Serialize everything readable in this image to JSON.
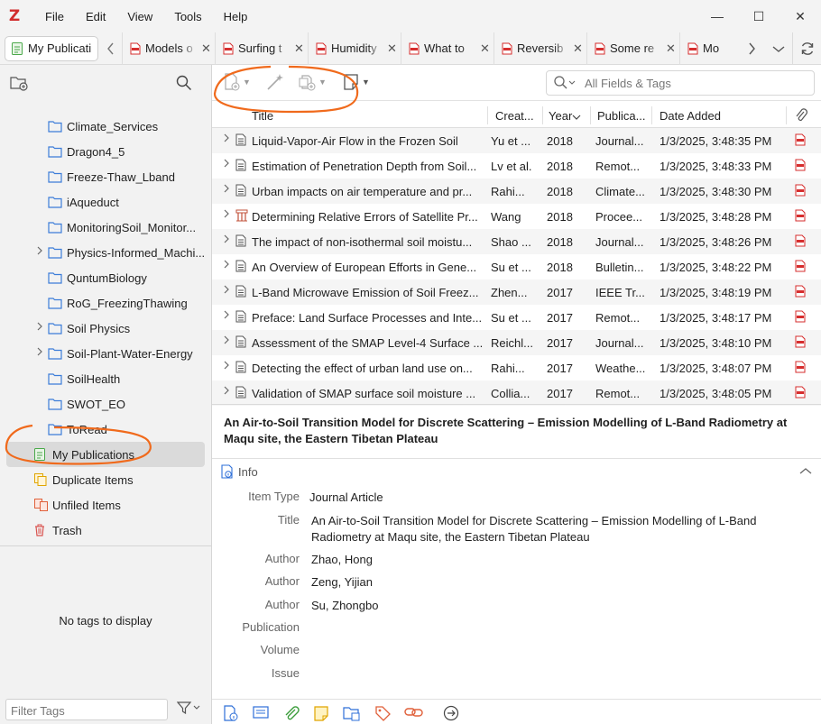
{
  "app": {
    "logo": "Z"
  },
  "menu": [
    "File",
    "Edit",
    "View",
    "Tools",
    "Help"
  ],
  "window_controls": {
    "minimize": "—",
    "maximize": "☐",
    "close": "✕"
  },
  "library_tab": {
    "label": "My Publicati"
  },
  "tabs": [
    {
      "label": "Models o"
    },
    {
      "label": "Surfing t"
    },
    {
      "label": "Humidity"
    },
    {
      "label": "What to"
    },
    {
      "label": "Reversib"
    },
    {
      "label": "Some re"
    },
    {
      "label": "Mo"
    }
  ],
  "collections": [
    {
      "label": "Climate_Services",
      "twisty": false
    },
    {
      "label": "Dragon4_5",
      "twisty": false
    },
    {
      "label": "Freeze-Thaw_Lband",
      "twisty": false
    },
    {
      "label": "iAqueduct",
      "twisty": false
    },
    {
      "label": "MonitoringSoil_Monitor...",
      "twisty": false
    },
    {
      "label": "Physics-Informed_Machi...",
      "twisty": true
    },
    {
      "label": "QuntumBiology",
      "twisty": false
    },
    {
      "label": "RoG_FreezingThawing",
      "twisty": false
    },
    {
      "label": "Soil Physics",
      "twisty": true
    },
    {
      "label": "Soil-Plant-Water-Energy",
      "twisty": true
    },
    {
      "label": "SoilHealth",
      "twisty": false
    },
    {
      "label": "SWOT_EO",
      "twisty": false
    },
    {
      "label": "ToRead",
      "twisty": false
    }
  ],
  "special": {
    "my_publications": "My Publications",
    "duplicate_items": "Duplicate Items",
    "unfiled_items": "Unfiled Items",
    "trash": "Trash"
  },
  "tags": {
    "empty": "No tags to display",
    "filter_placeholder": "Filter Tags"
  },
  "search": {
    "placeholder": "All Fields & Tags"
  },
  "columns": {
    "title": "Title",
    "creator": "Creat...",
    "year": "Year",
    "publication": "Publica...",
    "date_added": "Date Added"
  },
  "items": [
    {
      "title": "Liquid-Vapor-Air Flow in the Frozen Soil",
      "creator": "Yu et ...",
      "year": "2018",
      "publication": "Journal...",
      "date_added": "1/3/2025, 3:48:35 PM",
      "type": "article"
    },
    {
      "title": "Estimation of Penetration Depth from Soil...",
      "creator": "Lv et al.",
      "year": "2018",
      "publication": "Remot...",
      "date_added": "1/3/2025, 3:48:33 PM",
      "type": "article"
    },
    {
      "title": "Urban impacts on air temperature and pr...",
      "creator": "Rahi...",
      "year": "2018",
      "publication": "Climate...",
      "date_added": "1/3/2025, 3:48:30 PM",
      "type": "article"
    },
    {
      "title": "Determining Relative Errors of Satellite Pr...",
      "creator": "Wang",
      "year": "2018",
      "publication": "Procee...",
      "date_added": "1/3/2025, 3:48:28 PM",
      "type": "conference"
    },
    {
      "title": "The impact of non-isothermal soil moistu...",
      "creator": "Shao ...",
      "year": "2018",
      "publication": "Journal...",
      "date_added": "1/3/2025, 3:48:26 PM",
      "type": "article"
    },
    {
      "title": "An Overview of European Efforts in Gene...",
      "creator": "Su et ...",
      "year": "2018",
      "publication": "Bulletin...",
      "date_added": "1/3/2025, 3:48:22 PM",
      "type": "article"
    },
    {
      "title": "L-Band Microwave Emission of Soil Freez...",
      "creator": "Zhen...",
      "year": "2017",
      "publication": "IEEE Tr...",
      "date_added": "1/3/2025, 3:48:19 PM",
      "type": "article"
    },
    {
      "title": "Preface: Land Surface Processes and Inte...",
      "creator": "Su et ...",
      "year": "2017",
      "publication": "Remot...",
      "date_added": "1/3/2025, 3:48:17 PM",
      "type": "article"
    },
    {
      "title": "Assessment of the SMAP Level-4 Surface ...",
      "creator": "Reichl...",
      "year": "2017",
      "publication": "Journal...",
      "date_added": "1/3/2025, 3:48:10 PM",
      "type": "article"
    },
    {
      "title": "Detecting the effect of urban land use on...",
      "creator": "Rahi...",
      "year": "2017",
      "publication": "Weathe...",
      "date_added": "1/3/2025, 3:48:07 PM",
      "type": "article"
    },
    {
      "title": "Validation of SMAP surface soil moisture ...",
      "creator": "Collia...",
      "year": "2017",
      "publication": "Remot...",
      "date_added": "1/3/2025, 3:48:05 PM",
      "type": "article"
    }
  ],
  "item_pane": {
    "header_title": "An Air-to-Soil Transition Model for Discrete Scattering – Emission Modelling of L-Band Radiometry at Maqu site, the Eastern Tibetan Plateau",
    "section": "Info",
    "fields": [
      {
        "key": "Item Type",
        "value": "Journal Article"
      },
      {
        "key": "Title",
        "value": "An Air-to-Soil Transition Model for Discrete Scattering – Emission Modelling of L-Band Radiometry at Maqu site, the Eastern Tibetan Plateau"
      },
      {
        "key": "Author",
        "value": "Zhao, Hong"
      },
      {
        "key": "Author",
        "value": "Zeng, Yijian"
      },
      {
        "key": "Author",
        "value": "Su, Zhongbo"
      },
      {
        "key": "Publication",
        "value": ""
      },
      {
        "key": "Volume",
        "value": ""
      },
      {
        "key": "Issue",
        "value": ""
      }
    ]
  },
  "colors": {
    "accent": "#2e6fd8",
    "annotation": "#f06a1c",
    "pdf": "#d62d2d",
    "folder": "#3c7dd9"
  }
}
